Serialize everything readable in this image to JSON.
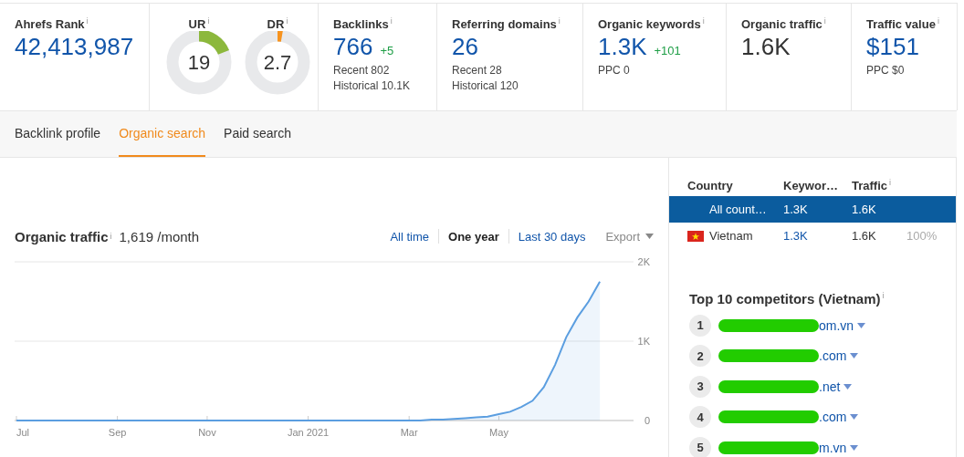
{
  "metrics": [
    {
      "kind": "stat",
      "label": "Ahrefs Rank",
      "info": "i",
      "value": "42,413,987",
      "linked": true
    },
    {
      "kind": "gauges",
      "gauges": [
        {
          "label": "UR",
          "info": "i",
          "value": "19",
          "level": 0.19,
          "color": "#8cb83c"
        },
        {
          "label": "DR",
          "info": "i",
          "value": "2.7",
          "level": 0.027,
          "color": "#f7931e"
        }
      ]
    },
    {
      "kind": "stat",
      "label": "Backlinks",
      "info": "i",
      "value": "766",
      "linked": true,
      "delta": "+5",
      "details": [
        "Recent 802",
        "Historical 10.1K"
      ]
    },
    {
      "kind": "stat",
      "label": "Referring domains",
      "info": "i",
      "value": "26",
      "linked": true,
      "details": [
        "Recent 28",
        "Historical 120"
      ]
    },
    {
      "kind": "stat",
      "label": "Organic keywords",
      "info": "i",
      "value": "1.3K",
      "linked": true,
      "delta": "+101",
      "details": [
        "PPC 0"
      ]
    },
    {
      "kind": "stat",
      "label": "Organic traffic",
      "info": "i",
      "value": "1.6K",
      "linked": false
    },
    {
      "kind": "stat",
      "label": "Traffic value",
      "info": "i",
      "value": "$151",
      "linked": true,
      "details": [
        "PPC $0"
      ]
    }
  ],
  "tabs": [
    {
      "label": "Backlink profile",
      "selected": false
    },
    {
      "label": "Organic search",
      "selected": true
    },
    {
      "label": "Paid search",
      "selected": false
    }
  ],
  "traffic": {
    "title": "Organic traffic",
    "info": "i",
    "summary": "1,619 /month",
    "ranges": [
      {
        "label": "All time",
        "selected": false
      },
      {
        "label": "One year",
        "selected": true
      },
      {
        "label": "Last 30 days",
        "selected": false
      }
    ],
    "export": "Export",
    "chart_data": {
      "type": "area",
      "ylim": [
        0,
        2000
      ],
      "categories": [
        "Jul",
        null,
        null,
        null,
        null,
        null,
        null,
        null,
        null,
        "Sep",
        null,
        null,
        null,
        null,
        null,
        null,
        null,
        "Nov",
        null,
        null,
        null,
        null,
        null,
        null,
        null,
        null,
        "Jan 2021",
        null,
        null,
        null,
        null,
        null,
        null,
        null,
        null,
        "Mar",
        null,
        null,
        null,
        null,
        null,
        null,
        null,
        "May",
        null,
        null,
        null,
        null,
        null,
        null,
        null,
        null,
        null,
        null,
        null,
        null
      ],
      "yticks": [
        {
          "value": 0,
          "label": "0"
        },
        {
          "value": 1000,
          "label": "1K"
        },
        {
          "value": 2000,
          "label": "2K"
        }
      ],
      "series": [
        {
          "color": "#5b9ee0",
          "values": [
            0,
            0,
            0,
            0,
            0,
            0,
            0,
            0,
            0,
            0,
            0,
            0,
            0,
            0,
            0,
            0,
            0,
            0,
            0,
            0,
            0,
            0,
            0,
            0,
            0,
            0,
            0,
            0,
            0,
            0,
            0,
            0,
            0,
            0,
            0,
            0,
            0,
            10,
            10,
            20,
            30,
            40,
            50,
            80,
            110,
            170,
            250,
            420,
            700,
            1050,
            1300,
            1500,
            1750,
            null,
            null,
            null
          ]
        }
      ]
    }
  },
  "countries": {
    "columns": [
      {
        "label": "Country"
      },
      {
        "label": "Keywor…"
      },
      {
        "label": "Traffic",
        "info": "i"
      }
    ],
    "rows": [
      {
        "kind": "all",
        "country": "All count…",
        "keywords": "1.3K",
        "traffic": "1.6K",
        "selected": true
      },
      {
        "kind": "flag",
        "country": "Vietnam",
        "keywords": "1.3K",
        "traffic": "1.6K",
        "share": "100%",
        "selected": false
      }
    ]
  },
  "competitors": {
    "title": "Top 10 competitors (Vietnam)",
    "info": "i",
    "items": [
      {
        "rank": "1",
        "domain": "om.vn"
      },
      {
        "rank": "2",
        "domain": ".com"
      },
      {
        "rank": "3",
        "domain": ".net"
      },
      {
        "rank": "4",
        "domain": ".com"
      },
      {
        "rank": "5",
        "domain": "m.vn"
      }
    ]
  }
}
